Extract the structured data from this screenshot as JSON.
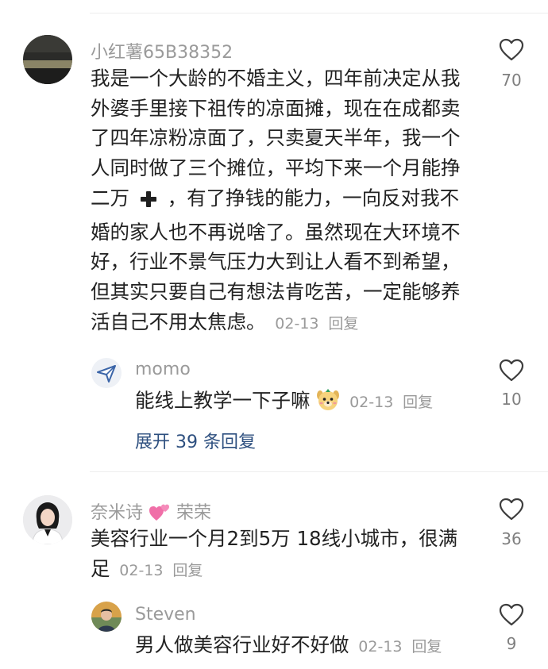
{
  "comments": [
    {
      "username": "小红薯65B38352",
      "text_lines": [
        "我是一个大龄的不婚主义，四年前决定从我",
        "外婆手里接下祖传的凉面摊，现在在成都卖",
        "了四年凉粉凉面了，只卖夏天半年，我一个",
        "人同时做了三个摊位，平均下来一个月能挣",
        "二万",
        "，有了挣钱的能力，一向反对我不",
        "婚的家人也不再说啥了。虽然现在大环境不",
        "好，行业不景气压力大到让人看不到希望，",
        "但其实只要自己有想法肯吃苦，一定能够养",
        "活自己不用太焦虑。"
      ],
      "date": "02-13",
      "reply_label": "回复",
      "likes": "70",
      "replies": [
        {
          "username": "momo",
          "text": "能线上教学一下子嘛",
          "date": "02-13",
          "reply_label": "回复",
          "likes": "10"
        }
      ],
      "expand_label": "展开 39 条回复"
    },
    {
      "username_part1": "奈米诗",
      "username_part2": "荣荣",
      "text_line1": "美容行业一个月2到5万 18线小城市，很满",
      "text_line2": "足",
      "date": "02-13",
      "reply_label": "回复",
      "likes": "36",
      "replies": [
        {
          "username": "Steven",
          "text": "男人做美容行业好不好做",
          "date": "02-13",
          "reply_label": "回复",
          "likes": "9"
        }
      ]
    }
  ],
  "icons": {
    "like": "heart-outline-icon",
    "plus": "plus-icon",
    "heart_emoji": "two-hearts-emoji",
    "dog_emoji": "dog-face-emoji"
  },
  "colors": {
    "text": "#222222",
    "meta": "#9a9a9a",
    "link": "#2d4f7f",
    "divider": "#ededed"
  }
}
